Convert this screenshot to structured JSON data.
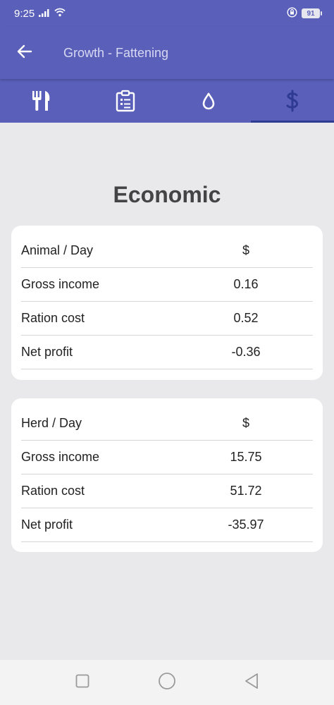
{
  "status_bar": {
    "time": "9:25",
    "battery": "91"
  },
  "app_bar": {
    "title": "Growth - Fattening"
  },
  "tabs": [
    {
      "icon": "fork-knife-icon",
      "active": false
    },
    {
      "icon": "clipboard-list-icon",
      "active": false
    },
    {
      "icon": "water-drop-icon",
      "active": false
    },
    {
      "icon": "dollar-icon",
      "active": true
    }
  ],
  "page": {
    "title": "Economic"
  },
  "animal_table": {
    "header_label": "Animal / Day",
    "header_unit": "$",
    "rows": [
      {
        "label": "Gross income",
        "value": "0.16"
      },
      {
        "label": "Ration cost",
        "value": "0.52"
      },
      {
        "label": "Net profit",
        "value": "-0.36"
      }
    ]
  },
  "herd_table": {
    "header_label": "Herd / Day",
    "header_unit": "$",
    "rows": [
      {
        "label": "Gross income",
        "value": "15.75"
      },
      {
        "label": "Ration cost",
        "value": "51.72"
      },
      {
        "label": "Net profit",
        "value": "-35.97"
      }
    ]
  },
  "colors": {
    "primary": "#5a5fb9",
    "active_tab": "#2f3a91",
    "background": "#e9e9ec"
  }
}
